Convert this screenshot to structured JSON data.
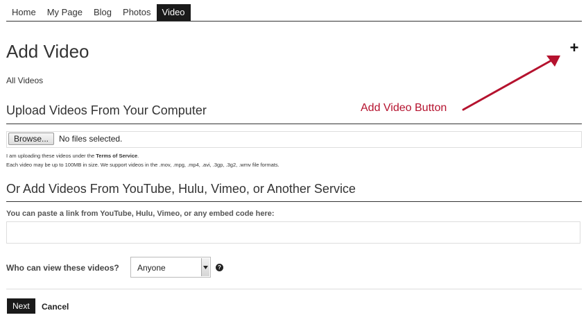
{
  "nav": {
    "items": [
      {
        "label": "Home"
      },
      {
        "label": "My Page"
      },
      {
        "label": "Blog"
      },
      {
        "label": "Photos"
      },
      {
        "label": "Video",
        "active": true
      }
    ]
  },
  "page": {
    "title": "Add Video",
    "add_icon": "plus-icon",
    "all_videos_label": "All Videos"
  },
  "upload": {
    "heading": "Upload Videos From Your Computer",
    "browse_label": "Browse...",
    "file_status": "No files selected.",
    "tos_prefix": "I am uploading these videos under the ",
    "tos_link": "Terms of Service",
    "tos_suffix": ".",
    "size_note": "Each video may be up to 100MB in size. We support videos in the .mov, .mpg, .mp4, .avi, .3gp, .3g2, .wmv file formats."
  },
  "embed": {
    "heading": "Or Add Videos From YouTube, Hulu, Vimeo, or Another Service",
    "label": "You can paste a link from YouTube, Hulu, Vimeo, or any embed code here:",
    "value": "",
    "placeholder": ""
  },
  "privacy": {
    "label": "Who can view these videos?",
    "selected": "Anyone",
    "help_icon": "question-circle-icon"
  },
  "actions": {
    "next_label": "Next",
    "cancel_label": "Cancel"
  },
  "annotation": {
    "label": "Add Video Button",
    "color": "#b5122e"
  }
}
